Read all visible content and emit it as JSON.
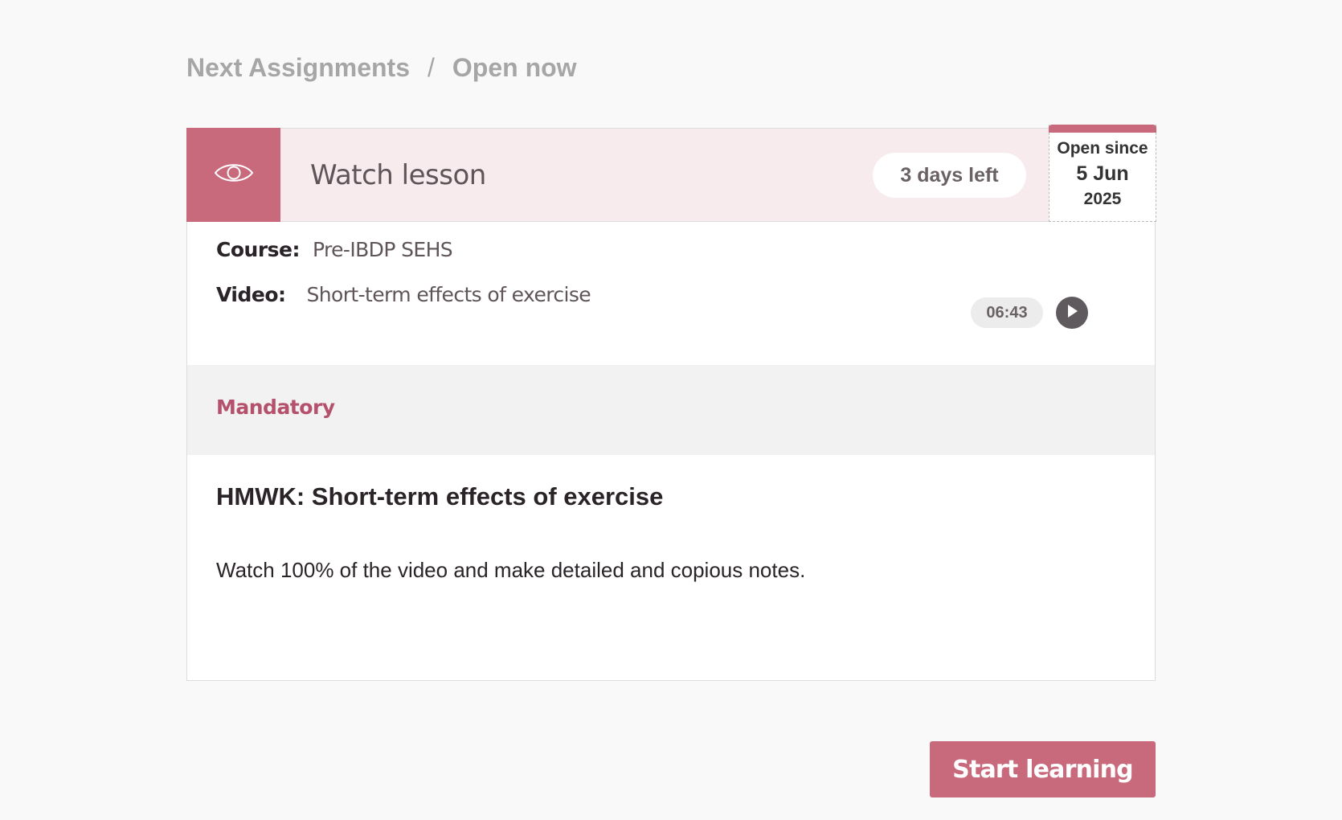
{
  "breadcrumb": {
    "items": [
      "Next Assignments",
      "Open now"
    ],
    "separator": "/"
  },
  "assignment": {
    "type_icon": "eye-icon",
    "title": "Watch lesson",
    "days_left": "3 days left",
    "open_since": {
      "label": "Open since",
      "date": "5 Jun",
      "year": "2025"
    },
    "course_label": "Course:",
    "course": "Pre-IBDP SEHS",
    "video_label": "Video:",
    "video": "Short-term effects of exercise",
    "video_duration": "06:43",
    "play_icon": "play-icon",
    "requirement": "Mandatory",
    "task_title": "HMWK: Short-term effects of exercise",
    "task_description": "Watch 100% of the video and make detailed and copious notes."
  },
  "actions": {
    "start_label": "Start learning"
  },
  "colors": {
    "accent": "#c96a7c",
    "header_bg": "#f7ebee",
    "mandatory_text": "#b5516d",
    "page_bg": "#f9f9f9"
  }
}
